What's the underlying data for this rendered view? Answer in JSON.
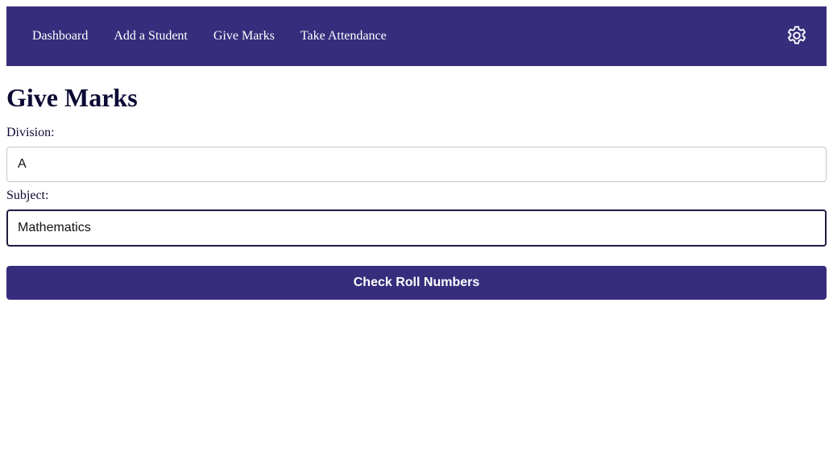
{
  "nav": {
    "items": [
      {
        "label": "Dashboard"
      },
      {
        "label": "Add a Student"
      },
      {
        "label": "Give Marks"
      },
      {
        "label": "Take Attendance"
      }
    ],
    "settings_icon": "gear-icon",
    "background_color": "#372d7d"
  },
  "page": {
    "title": "Give Marks"
  },
  "form": {
    "division": {
      "label": "Division:",
      "value": "A"
    },
    "subject": {
      "label": "Subject:",
      "value": "Mathematics"
    },
    "submit_label": "Check Roll Numbers"
  },
  "colors": {
    "primary": "#372d7d",
    "text": "#0c0a33"
  }
}
